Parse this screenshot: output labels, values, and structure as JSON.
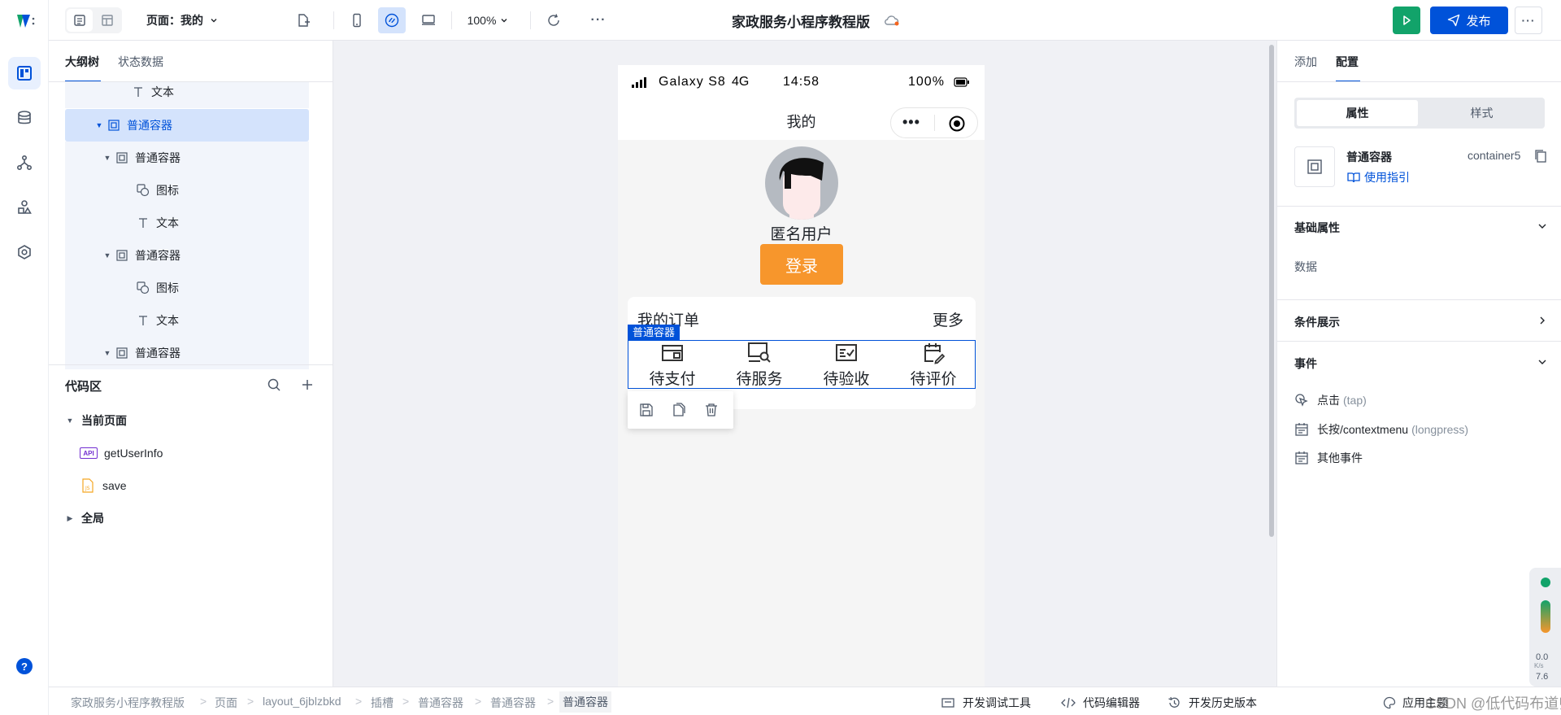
{
  "topbar": {
    "page_label": "页面：我的",
    "zoom": "100%",
    "app_title": "家政服务小程序教程版",
    "publish_label": "发布"
  },
  "left_panel": {
    "tabs": [
      "大纲树",
      "状态数据"
    ],
    "tree": [
      {
        "label": "文本",
        "icon": "text-icon"
      },
      {
        "label": "普通容器",
        "icon": "container-icon",
        "selected": true
      },
      {
        "label": "普通容器",
        "icon": "container-icon"
      },
      {
        "label": "图标",
        "icon": "icon-component-icon"
      },
      {
        "label": "文本",
        "icon": "text-icon"
      },
      {
        "label": "普通容器",
        "icon": "container-icon"
      },
      {
        "label": "图标",
        "icon": "icon-component-icon"
      },
      {
        "label": "文本",
        "icon": "text-icon"
      },
      {
        "label": "普通容器",
        "icon": "container-icon"
      }
    ],
    "code_area": {
      "title": "代码区",
      "current_page": "当前页面",
      "items": [
        {
          "label": "getUserInfo",
          "icon": "api-icon",
          "badge": "API"
        },
        {
          "label": "save",
          "icon": "js-file-icon",
          "badge": "JS"
        }
      ],
      "global": "全局"
    }
  },
  "phone": {
    "carrier": "Galaxy S8",
    "network": "4G",
    "time": "14:58",
    "battery": "100%",
    "nav_title": "我的",
    "user_name": "匿名用户",
    "login_label": "登录",
    "orders_title": "我的订单",
    "more_label": "更多",
    "selection_tag": "普通容器",
    "order_items": [
      {
        "label": "待支付",
        "icon": "wallet-icon"
      },
      {
        "label": "待服务",
        "icon": "service-search-icon"
      },
      {
        "label": "待验收",
        "icon": "check-list-icon"
      },
      {
        "label": "待评价",
        "icon": "review-edit-icon"
      }
    ]
  },
  "right_panel": {
    "tabs": [
      "添加",
      "配置"
    ],
    "segment": [
      "属性",
      "样式"
    ],
    "component_name": "普通容器",
    "component_id": "container5",
    "guide_label": "使用指引",
    "basic_props_title": "基础属性",
    "data_label": "数据",
    "conditional_title": "条件展示",
    "events_title": "事件",
    "events": [
      {
        "label": "点击",
        "hint": "(tap)",
        "icon": "tap-icon"
      },
      {
        "label": "长按/contextmenu",
        "hint": "(longpress)",
        "icon": "calendar-icon"
      },
      {
        "label": "其他事件",
        "hint": "",
        "icon": "calendar-icon"
      }
    ]
  },
  "bottombar": {
    "breadcrumb": [
      "家政服务小程序教程版",
      "页面",
      "layout_6jblzbkd",
      "插槽",
      "普通容器",
      "普通容器",
      "普通容器"
    ],
    "devtools_label": "开发调试工具",
    "code_editor_label": "代码编辑器",
    "history_label": "开发历史版本",
    "theme_label": "应用主题",
    "watermark": "CSDN @低代码布道师"
  },
  "perf_widget": {
    "value": "0.0",
    "unit": "K/s",
    "value2": "7.6"
  },
  "colors": {
    "brand": "#0052d9",
    "orange": "#f7962c",
    "run_green": "#12a36a",
    "selected_row": "#d4e3fc"
  }
}
